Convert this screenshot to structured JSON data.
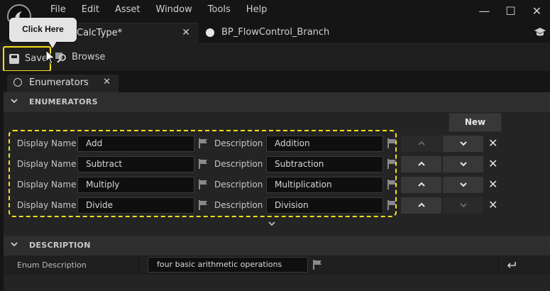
{
  "menu": {
    "items": [
      "File",
      "Edit",
      "Asset",
      "Window",
      "Tools",
      "Help"
    ]
  },
  "window_controls": {
    "minimize": "—",
    "maximize": "☐",
    "close": "✕"
  },
  "doc_tabs": {
    "active_label": "CalcType*",
    "active_close": "✕",
    "inactive_label": "BP_FlowControl_Branch"
  },
  "callout": {
    "text": "Click Here"
  },
  "toolbar": {
    "save_label": "Save",
    "browse_label": "Browse"
  },
  "panel_tab": {
    "label": "Enumerators",
    "close": "✕"
  },
  "sections": {
    "enumerators_title": "ENUMERATORS",
    "description_title": "DESCRIPTION"
  },
  "new_button": "New",
  "enum_rows": [
    {
      "display_name_label": "Display Name",
      "display_name": "Add",
      "description_label": "Description",
      "description": "Addition",
      "can_move_up": false,
      "can_move_down": true
    },
    {
      "display_name_label": "Display Name",
      "display_name": "Subtract",
      "description_label": "Description",
      "description": "Subtraction",
      "can_move_up": true,
      "can_move_down": true
    },
    {
      "display_name_label": "Display Name",
      "display_name": "Multiply",
      "description_label": "Description",
      "description": "Multiplication",
      "can_move_up": true,
      "can_move_down": true
    },
    {
      "display_name_label": "Display Name",
      "display_name": "Divide",
      "description_label": "Description",
      "description": "Division",
      "can_move_up": true,
      "can_move_down": false
    }
  ],
  "delete_glyph": "✕",
  "enum_description": {
    "label": "Enum Description",
    "value": "four basic arithmetic operations"
  },
  "colors": {
    "highlight": "#f5e11a",
    "panel_bg": "#242424",
    "field_bg": "#0f0f0f"
  },
  "icons": [
    "ue-logo-icon",
    "save-icon",
    "browse-icon",
    "enum-icon",
    "flag-icon",
    "chevron-up-icon",
    "chevron-down-icon",
    "close-icon",
    "reset-arrow-icon"
  ]
}
